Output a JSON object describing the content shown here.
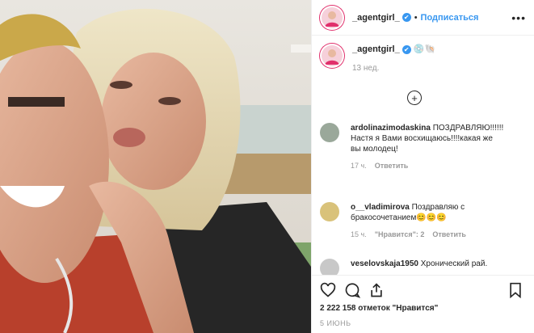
{
  "post": {
    "username": "_agentgirl_",
    "verified_glyph": "✔",
    "separator": "•",
    "follow_label": "Подписаться",
    "more_glyph": "•••",
    "caption": {
      "username": "_agentgirl_",
      "text": " 💿🐚",
      "time": "13 нед."
    },
    "load_more_glyph": "+",
    "comments": [
      {
        "username": "ardolinazimodaskina",
        "text": " ПОЗДРАВЛЯЮ!!!!!!Настя я Вами восхищаюсь!!!!какая же вы молодец!",
        "time": "17 ч.",
        "likes_label": "",
        "reply_label": "Ответить"
      },
      {
        "username": "o__vladimirova",
        "text": " Поздравляю с бракосочетанием😊😊😊",
        "time": "15 ч.",
        "likes_label": "\"Нравится\": 2",
        "reply_label": "Ответить"
      },
      {
        "username": "veselovskaja1950",
        "text": " Хронический рай.",
        "time": "",
        "likes_label": "",
        "reply_label": ""
      }
    ],
    "icons": [
      "heart-icon",
      "comment-icon",
      "share-icon",
      "bookmark-icon"
    ],
    "likes_text": "2 222 158 отметок \"Нравится\"",
    "date": "5 ИЮНЬ"
  }
}
